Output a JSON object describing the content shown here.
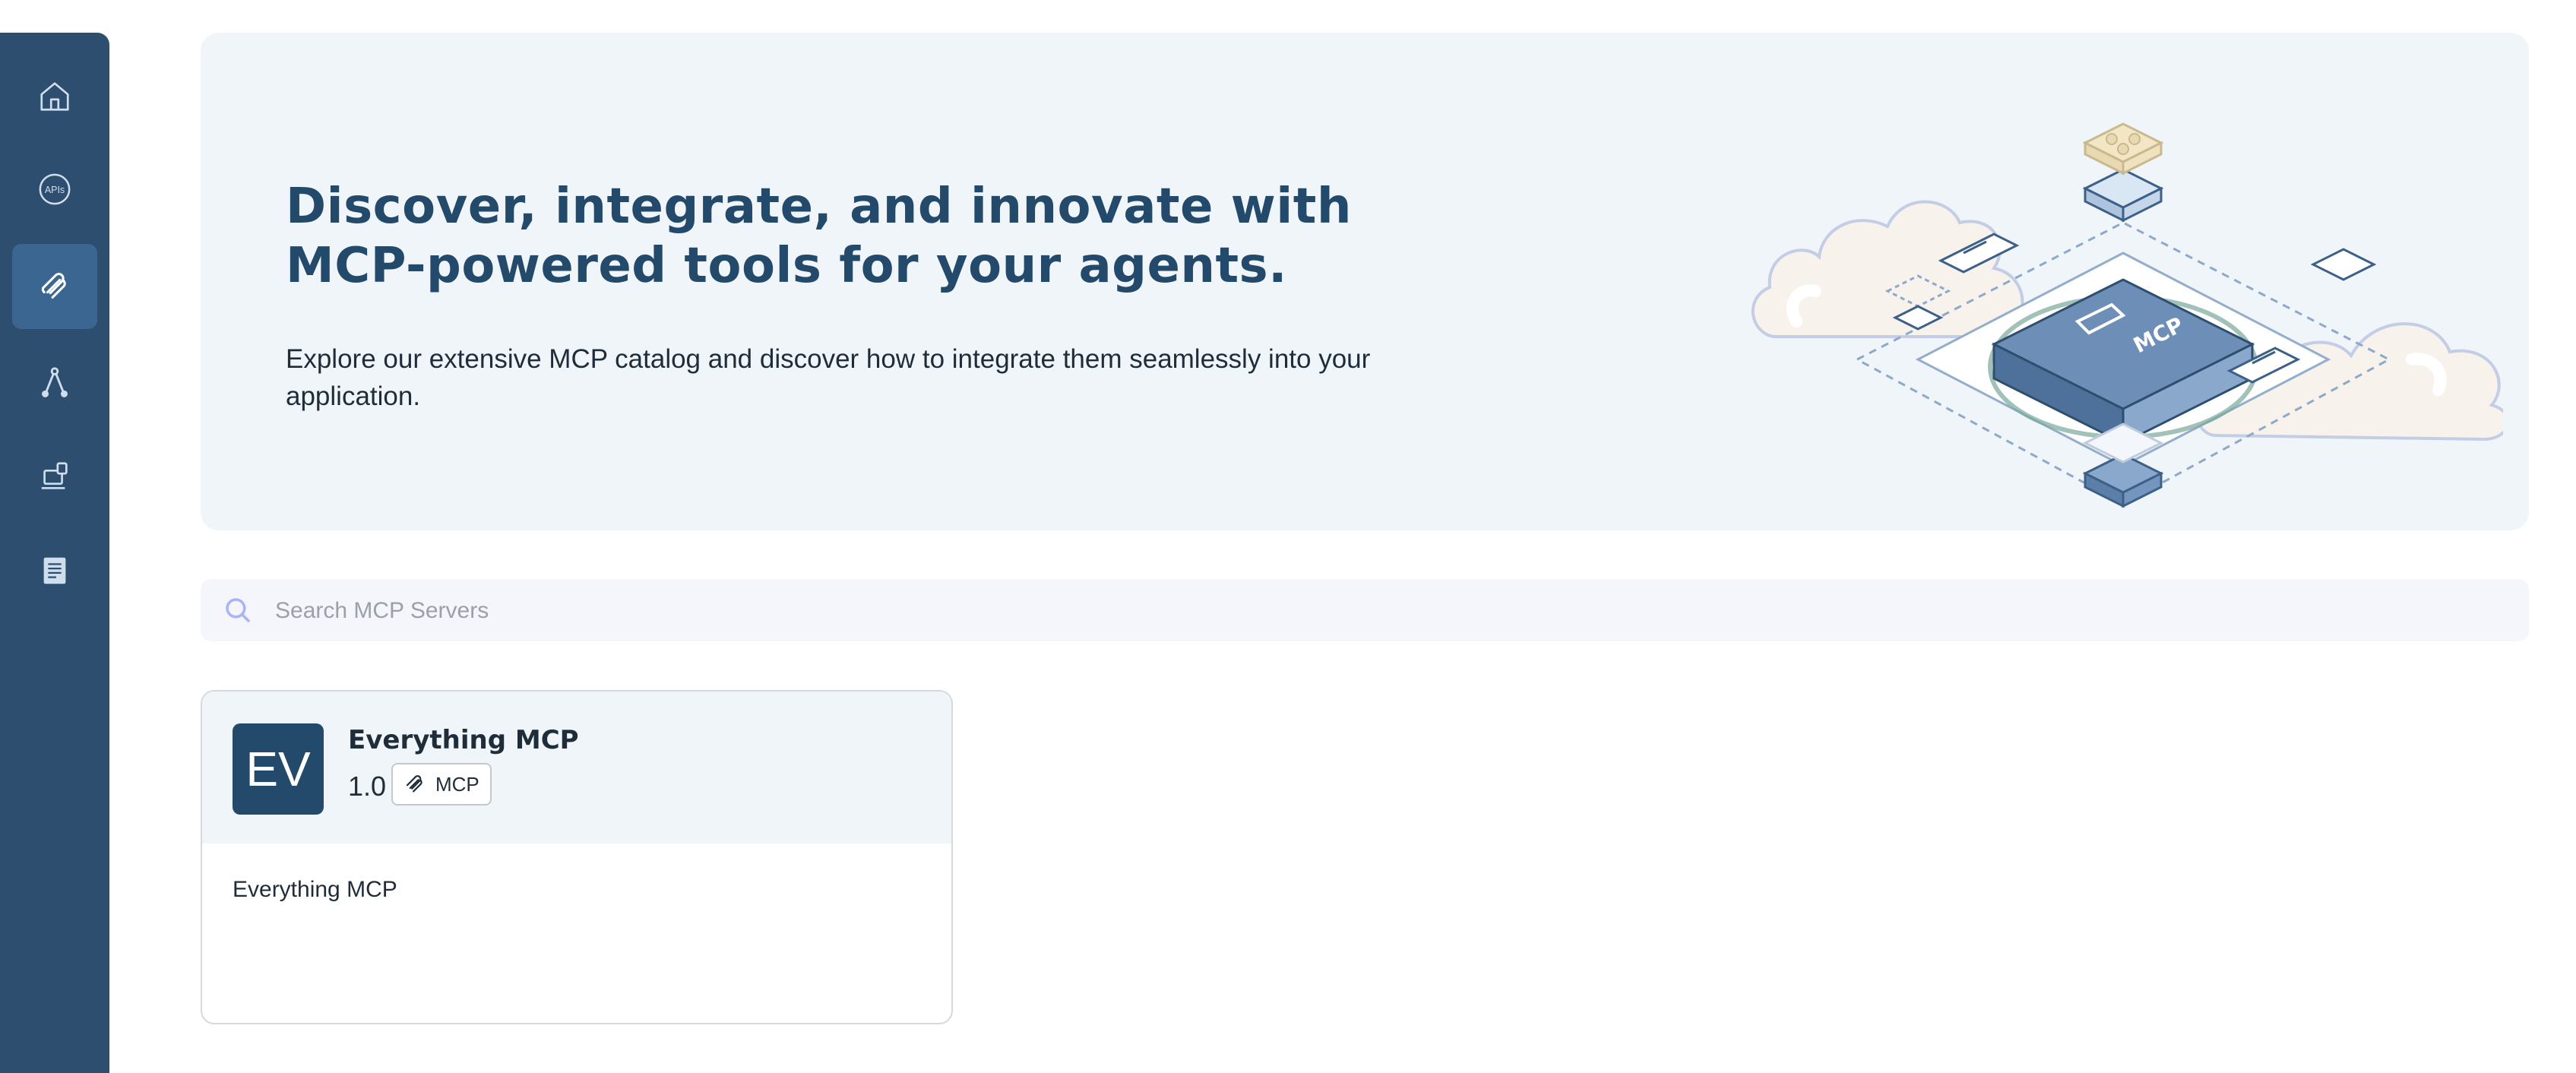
{
  "sidebar": {
    "items": [
      {
        "icon": "home-icon",
        "active": false
      },
      {
        "icon": "apis-icon",
        "label": "APIs",
        "active": false
      },
      {
        "icon": "mcp-icon",
        "active": true
      },
      {
        "icon": "flow-icon",
        "active": false
      },
      {
        "icon": "portal-icon",
        "active": false
      },
      {
        "icon": "docs-icon",
        "active": false
      }
    ]
  },
  "hero": {
    "title": "Discover, integrate, and innovate with MCP-powered tools for your agents.",
    "subtitle": "Explore our extensive MCP catalog and discover how to integrate them seamlessly into your application.",
    "illustration_label": "MCP"
  },
  "search": {
    "placeholder": "Search MCP Servers",
    "value": ""
  },
  "cards": [
    {
      "avatar": "EV",
      "title": "Everything MCP",
      "version": "1.0",
      "tag": "MCP",
      "description": "Everything MCP"
    }
  ],
  "colors": {
    "sidebar": "#2d4e6e",
    "sidebar_active": "#3a6691",
    "accent": "#244a6b",
    "hero_bg": "#f0f5fa"
  }
}
